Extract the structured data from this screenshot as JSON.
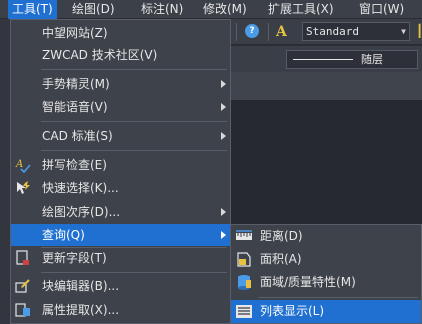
{
  "menubar": {
    "items": [
      "工具(T)",
      "绘图(D)",
      "标注(N)",
      "修改(M)",
      "扩展工具(X)",
      "窗口(W)"
    ]
  },
  "toolbar": {
    "help_icon_glyph": "?",
    "text_style_glyph": "A",
    "text_style_value": "Standard",
    "linetype_value": "随层"
  },
  "tools_menu": {
    "items": [
      {
        "label": "中望网站(Z)",
        "icon": "none",
        "submenu": false
      },
      {
        "label": "ZWCAD 技术社区(V)",
        "icon": "none",
        "submenu": false
      },
      {
        "label": "手势精灵(M)",
        "icon": "none",
        "submenu": true
      },
      {
        "label": "智能语音(V)",
        "icon": "none",
        "submenu": true
      },
      {
        "label": "CAD 标准(S)",
        "icon": "none",
        "submenu": true
      },
      {
        "label": "拼写检查(E)",
        "icon": "spell-check-icon",
        "submenu": false
      },
      {
        "label": "快速选择(K)...",
        "icon": "quick-select-icon",
        "submenu": false
      },
      {
        "label": "绘图次序(D)...",
        "icon": "none",
        "submenu": true
      },
      {
        "label": "查询(Q)",
        "icon": "none",
        "submenu": true,
        "highlighted": true
      },
      {
        "label": "更新字段(T)",
        "icon": "update-field-icon",
        "submenu": false
      },
      {
        "label": "块编辑器(B)...",
        "icon": "block-editor-icon",
        "submenu": false
      },
      {
        "label": "属性提取(X)...",
        "icon": "attribute-extract-icon",
        "submenu": false
      }
    ]
  },
  "inquiry_submenu": {
    "items": [
      {
        "label": "距离(D)",
        "icon": "distance-icon"
      },
      {
        "label": "面积(A)",
        "icon": "area-icon"
      },
      {
        "label": "面域/质量特性(M)",
        "icon": "mass-properties-icon"
      },
      {
        "label": "列表显示(L)",
        "icon": "list-icon",
        "highlighted": true
      }
    ]
  },
  "colors": {
    "highlight": "#1f70d0",
    "menu_bg": "#3e424b",
    "text": "#e6e6e6"
  }
}
